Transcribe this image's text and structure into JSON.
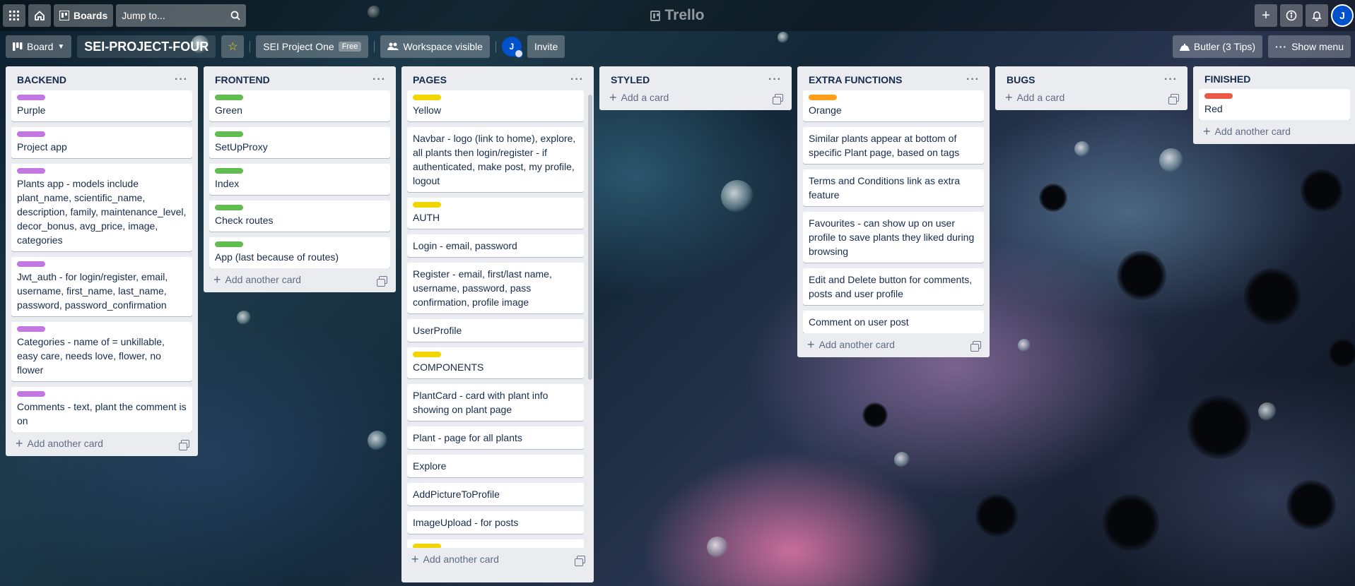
{
  "colors": {
    "purple": "#c377e0",
    "green": "#61bd4f",
    "yellow": "#f2d600",
    "orange": "#ff9f1a",
    "red": "#eb5a46"
  },
  "topbar": {
    "apps_icon": "grid-icon",
    "home_icon": "home-icon",
    "boards_label": "Boards",
    "search_placeholder": "Jump to...",
    "logo_text": "Trello",
    "avatar_initial": "J"
  },
  "boardbar": {
    "board_view_label": "Board",
    "title": "SEI-PROJECT-FOUR",
    "workspace_name": "SEI Project One",
    "workspace_badge": "Free",
    "visibility_label": "Workspace visible",
    "member_initial": "J",
    "invite_label": "Invite",
    "butler_label": "Butler (3 Tips)",
    "show_menu_label": "Show menu"
  },
  "add_card_label": "Add another card",
  "add_first_card_label": "Add a card",
  "lists": [
    {
      "title": "BACKEND",
      "cards": [
        {
          "label": "purple",
          "text": "Purple"
        },
        {
          "label": "purple",
          "text": "Project app"
        },
        {
          "label": "purple",
          "text": "Plants app - models include plant_name, scientific_name, description, family, maintenance_level, decor_bonus, avg_price, image, categories"
        },
        {
          "label": "purple",
          "text": "Jwt_auth - for login/register, email, username, first_name, last_name, password, password_confirmation"
        },
        {
          "label": "purple",
          "text": "Categories - name of = unkillable, easy care, needs love, flower, no flower"
        },
        {
          "label": "purple",
          "text": "Comments - text, plant the comment is on"
        }
      ]
    },
    {
      "title": "FRONTEND",
      "cards": [
        {
          "label": "green",
          "text": "Green"
        },
        {
          "label": "green",
          "text": "SetUpProxy"
        },
        {
          "label": "green",
          "text": "Index"
        },
        {
          "label": "green",
          "text": "Check routes"
        },
        {
          "label": "green",
          "text": "App (last because of routes)"
        }
      ]
    },
    {
      "title": "PAGES",
      "cards": [
        {
          "label": "yellow",
          "text": "Yellow"
        },
        {
          "label": "",
          "text": "Navbar - logo (link to home), explore, all plants then login/register - if authenticated, make post, my profile, logout"
        },
        {
          "label": "yellow",
          "text": "AUTH"
        },
        {
          "label": "",
          "text": "Login - email, password"
        },
        {
          "label": "",
          "text": "Register - email, first/last name, username, password, pass confirmation, profile image"
        },
        {
          "label": "",
          "text": "UserProfile"
        },
        {
          "label": "yellow",
          "text": "COMPONENTS"
        },
        {
          "label": "",
          "text": "PlantCard - card with plant info showing on plant page"
        },
        {
          "label": "",
          "text": "Plant - page for all plants"
        },
        {
          "label": "",
          "text": "Explore"
        },
        {
          "label": "",
          "text": "AddPictureToProfile"
        },
        {
          "label": "",
          "text": "ImageUpload - for posts"
        },
        {
          "label": "yellow",
          "text": ""
        }
      ]
    },
    {
      "title": "STYLED",
      "cards": []
    },
    {
      "title": "EXTRA FUNCTIONS",
      "cards": [
        {
          "label": "orange",
          "text": "Orange"
        },
        {
          "label": "",
          "text": "Similar plants appear at bottom of specific Plant page, based on tags"
        },
        {
          "label": "",
          "text": "Terms and Conditions link as extra feature"
        },
        {
          "label": "",
          "text": "Favourites - can show up on user profile to save plants they liked during browsing"
        },
        {
          "label": "",
          "text": "Edit and Delete button for comments, posts and user profile"
        },
        {
          "label": "",
          "text": "Comment on user post"
        }
      ]
    },
    {
      "title": "BUGS",
      "cards": []
    },
    {
      "title": "FINISHED",
      "cards": [
        {
          "label": "red",
          "text": "Red"
        }
      ]
    }
  ]
}
